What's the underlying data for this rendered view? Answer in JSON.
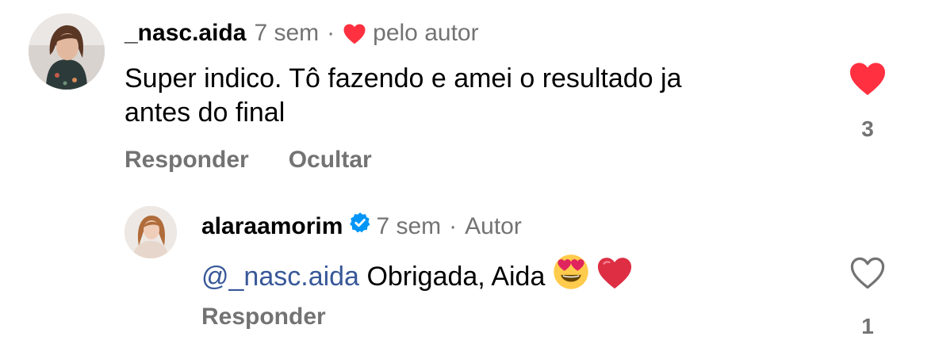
{
  "comments": [
    {
      "username": "_nasc.aida",
      "time": "7 sem",
      "separator": "·",
      "tag": "pelo autor",
      "text": "Super indico. Tô fazendo e amei o resultado ja antes do final",
      "text_line1": "Super indico. Tô fazendo e amei o resultado ja",
      "text_line2": "antes do final",
      "reply_label": "Responder",
      "hide_label": "Ocultar",
      "like_count": "3",
      "liked": true,
      "heart_color": "#ff3040"
    },
    {
      "username": "alaraamorim",
      "verified": true,
      "verified_color": "#0095f6",
      "time": "7 sem",
      "separator": "·",
      "tag": "Autor",
      "mention": "@_nasc.aida",
      "text": "Obrigada, Aida",
      "emojis": [
        "heart-eyes-emoji",
        "red-heart-emoji"
      ],
      "reply_label": "Responder",
      "like_count": "1",
      "liked": false
    }
  ],
  "colors": {
    "muted": "#737373",
    "mention": "#385898",
    "like_red": "#ff3040"
  }
}
